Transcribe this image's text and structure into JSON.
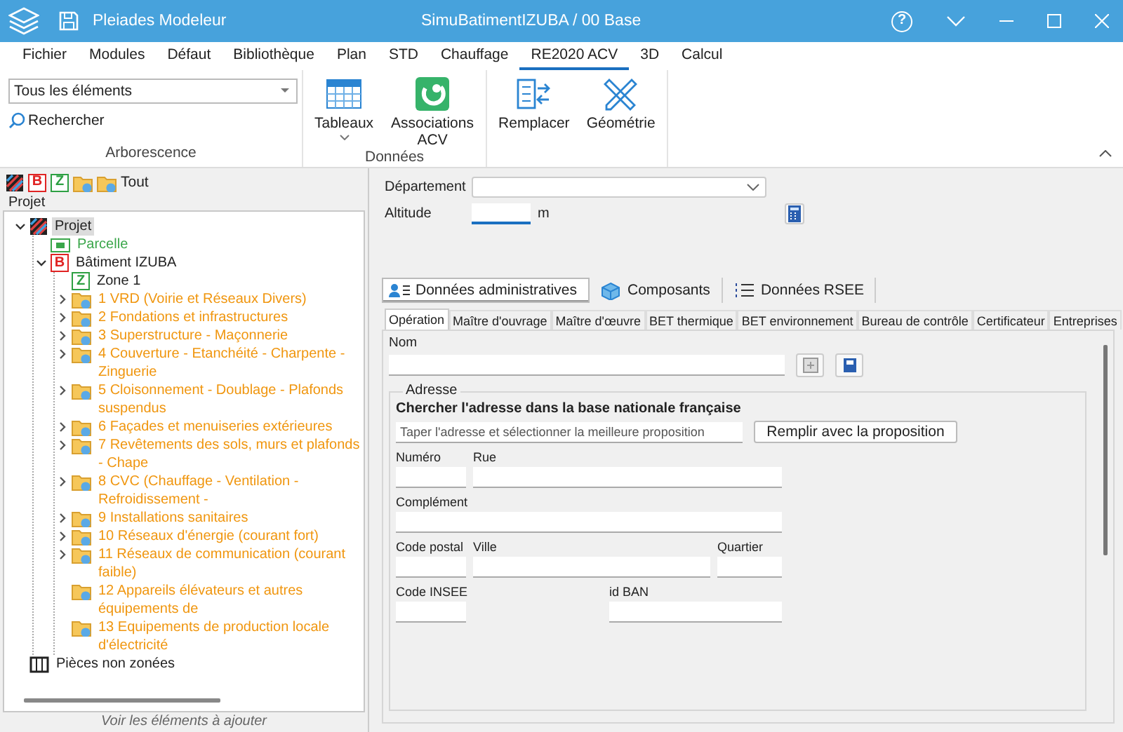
{
  "window": {
    "app_title": "Pleiades Modeleur",
    "document_title": "SimuBatimentIZUBA / 00 Base",
    "help_glyph": "?"
  },
  "menu_tabs": [
    {
      "label": "Fichier",
      "selected": false
    },
    {
      "label": "Modules",
      "selected": false
    },
    {
      "label": "Défaut",
      "selected": false
    },
    {
      "label": "Bibliothèque",
      "selected": false
    },
    {
      "label": "Plan",
      "selected": false
    },
    {
      "label": "STD",
      "selected": false
    },
    {
      "label": "Chauffage",
      "selected": false
    },
    {
      "label": "RE2020 ACV",
      "selected": true
    },
    {
      "label": "3D",
      "selected": false
    },
    {
      "label": "Calcul",
      "selected": false
    }
  ],
  "ribbon": {
    "filter": {
      "value": "Tous les éléments"
    },
    "search_link": "Rechercher",
    "tree_group_label": "Arborescence",
    "groups": [
      {
        "label": "Données",
        "buttons": [
          {
            "label": "Tableaux",
            "dropdown": true
          },
          {
            "label": "Associations ACV",
            "dropdown": false
          }
        ]
      },
      {
        "buttons": [
          {
            "label": "Remplacer",
            "dropdown": false
          },
          {
            "label": "Géométrie",
            "dropdown": false
          }
        ]
      }
    ]
  },
  "left_toolbar": [
    {
      "kind": "project"
    },
    {
      "kind": "building",
      "icon_text": "B"
    },
    {
      "kind": "zone",
      "icon_text": "Z"
    },
    {
      "kind": "lot"
    },
    {
      "kind": "lot",
      "label": "Tout"
    }
  ],
  "tree": {
    "label": "Projet",
    "items": [
      {
        "label": "Projet",
        "kind": "project",
        "selected": true,
        "expanded": true,
        "children": [
          {
            "label": "Parcelle",
            "kind": "parcel",
            "selected": false
          },
          {
            "label": "Bâtiment IZUBA",
            "kind": "building",
            "icon_text": "B",
            "selected": false,
            "expanded": true,
            "children": [
              {
                "label": "Zone 1",
                "kind": "zone",
                "icon_text": "Z",
                "selected": false
              },
              {
                "label": "1 VRD (Voirie et Réseaux Divers)",
                "kind": "lot",
                "selected": false,
                "expanded": false
              },
              {
                "label": "2 Fondations et infrastructures",
                "kind": "lot",
                "selected": false,
                "expanded": false
              },
              {
                "label": "3 Superstructure - Maçonnerie",
                "kind": "lot",
                "selected": false,
                "expanded": false
              },
              {
                "label": "4 Couverture - Etanchéité - Charpente - Zinguerie",
                "kind": "lot",
                "selected": false,
                "expanded": false
              },
              {
                "label": "5 Cloisonnement - Doublage - Plafonds suspendus",
                "kind": "lot",
                "selected": false,
                "expanded": false
              },
              {
                "label": "6 Façades et menuiseries extérieures",
                "kind": "lot",
                "selected": false,
                "expanded": false
              },
              {
                "label": "7 Revêtements des sols, murs et plafonds - Chape",
                "kind": "lot",
                "selected": false,
                "expanded": false
              },
              {
                "label": "8 CVC (Chauffage - Ventilation - Refroidissement -",
                "kind": "lot",
                "selected": false,
                "expanded": false
              },
              {
                "label": "9 Installations sanitaires",
                "kind": "lot",
                "selected": false,
                "expanded": false
              },
              {
                "label": "10 Réseaux d'énergie (courant fort)",
                "kind": "lot",
                "selected": false,
                "expanded": false
              },
              {
                "label": "11 Réseaux de communication (courant faible)",
                "kind": "lot",
                "selected": false,
                "expanded": false
              },
              {
                "label": "12 Appareils élévateurs et autres équipements de",
                "kind": "lot",
                "selected": false
              },
              {
                "label": "13 Equipements de production locale d'électricité",
                "kind": "lot",
                "selected": false
              }
            ]
          }
        ]
      },
      {
        "label": "Pièces non zonées",
        "kind": "rooms",
        "selected": false
      }
    ]
  },
  "left_footer": "Voir les éléments à ajouter",
  "site": {
    "department": {
      "label": "Département"
    },
    "altitude": {
      "label": "Altitude",
      "unit": "m",
      "focused": true
    }
  },
  "section_tabs": [
    {
      "label": "Données administratives",
      "selected": true
    },
    {
      "label": "Composants",
      "selected": false
    },
    {
      "label": "Données RSEE",
      "selected": false
    }
  ],
  "sub_tabs": [
    {
      "label": "Opération",
      "selected": true
    },
    {
      "label": "Maître d'ouvrage",
      "selected": false
    },
    {
      "label": "Maître d'œuvre",
      "selected": false
    },
    {
      "label": "BET thermique",
      "selected": false
    },
    {
      "label": "BET environnement",
      "selected": false
    },
    {
      "label": "Bureau de contrôle",
      "selected": false
    },
    {
      "label": "Certificateur",
      "selected": false
    },
    {
      "label": "Entreprises",
      "selected": false
    }
  ],
  "operation": {
    "name_label": "Nom",
    "address": {
      "legend": "Adresse",
      "search_heading": "Chercher l'adresse dans la base nationale française",
      "search_placeholder": "Taper l'adresse et sélectionner la meilleure proposition",
      "fill_button": "Remplir avec la proposition",
      "fields": [
        {
          "label": "Numéro"
        },
        {
          "label": "Rue"
        },
        {
          "label": "Complément"
        },
        {
          "label": "Code postal"
        },
        {
          "label": "Ville"
        },
        {
          "label": "Quartier"
        },
        {
          "label": "Code INSEE"
        },
        {
          "label": "id BAN"
        }
      ]
    }
  }
}
